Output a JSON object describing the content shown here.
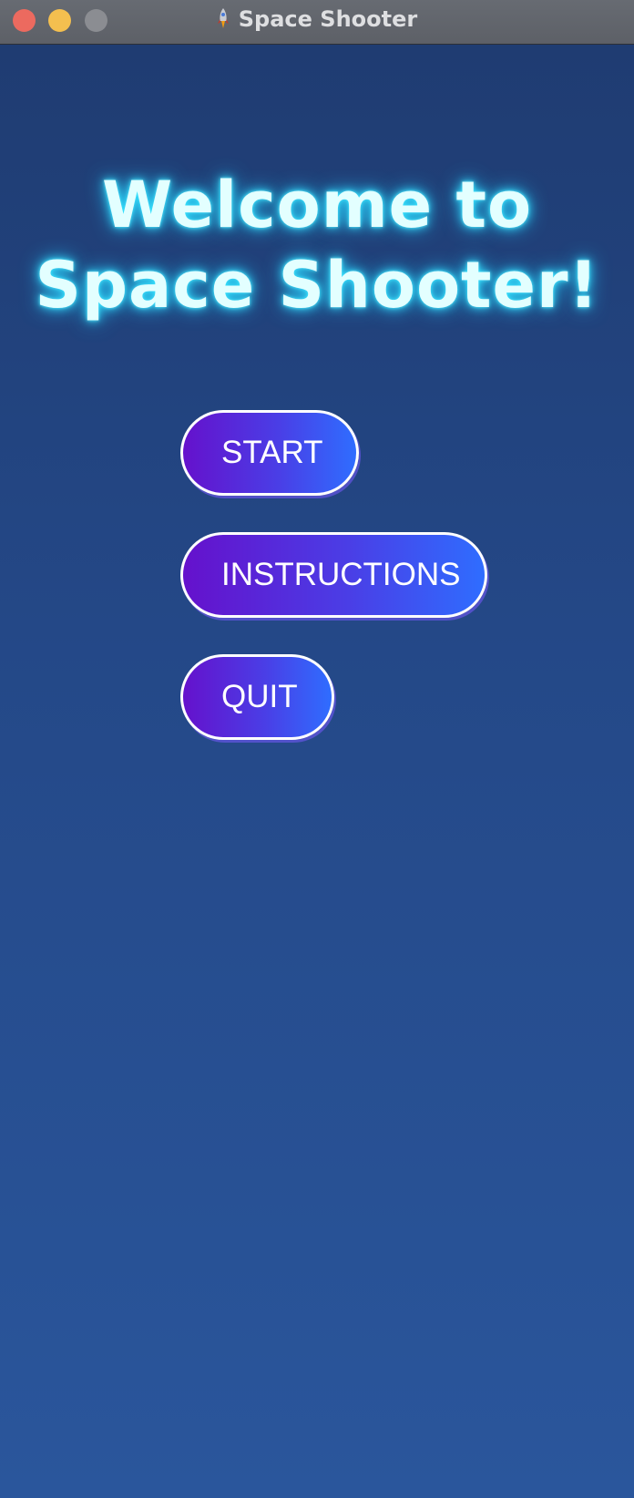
{
  "window": {
    "title": "Space Shooter",
    "title_icon": "rocket-icon",
    "controls": [
      "close",
      "minimize",
      "zoom"
    ]
  },
  "main": {
    "welcome_line1": "Welcome to",
    "welcome_line2": "Space Shooter!"
  },
  "menu": {
    "start_label": "START",
    "instructions_label": "INSTRUCTIONS",
    "quit_label": "QUIT"
  },
  "colors": {
    "background_top": "#1f3c72",
    "background_bottom": "#2a569c",
    "title_glow": "#37e6ff",
    "button_gradient_start": "#6511cc",
    "button_gradient_end": "#2f6dff",
    "button_border": "#ffffff"
  }
}
